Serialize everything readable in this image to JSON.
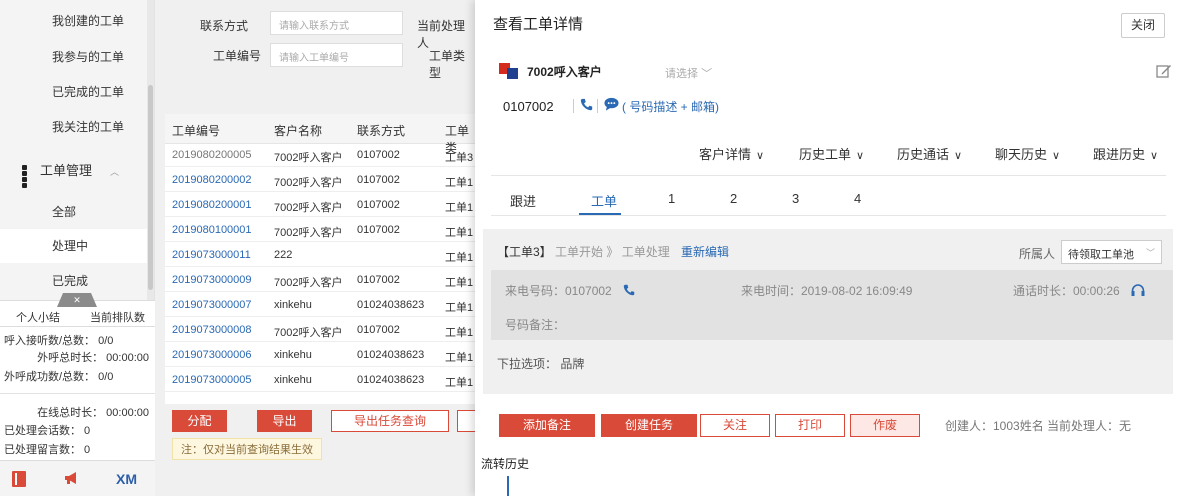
{
  "sidebar": {
    "items": [
      {
        "label": "我创建的工单"
      },
      {
        "label": "我参与的工单"
      },
      {
        "label": "已完成的工单"
      },
      {
        "label": "我关注的工单"
      }
    ],
    "group": {
      "label": "工单管理"
    },
    "group_items": [
      {
        "label": "全部"
      },
      {
        "label": "处理中"
      },
      {
        "label": "已完成"
      }
    ],
    "stats": {
      "tab_personal": "个人小结",
      "tab_queue": "当前排队数",
      "lines": [
        "呼入接听数/总数： 0/0",
        "外呼总时长： 00:00:00",
        "外呼成功数/总数： 0/0",
        "在线总时长： 00:00:00",
        "已处理会话数： 0",
        "已处理留言数： 0"
      ]
    },
    "bottom": {
      "xm": "XM"
    }
  },
  "form": {
    "contact_label": "联系方式",
    "contact_placeholder": "请输入联系方式",
    "handler_label": "当前处理人",
    "order_no_label": "工单编号",
    "order_no_placeholder": "请输入工单编号",
    "order_type_label": "工单类型"
  },
  "table": {
    "headers": [
      "工单编号",
      "客户名称",
      "联系方式",
      "工单类"
    ],
    "rows": [
      [
        "2019080200005",
        "7002呼入客户",
        "0107002",
        "工单3"
      ],
      [
        "2019080200002",
        "7002呼入客户",
        "0107002",
        "工单1"
      ],
      [
        "2019080200001",
        "7002呼入客户",
        "0107002",
        "工单1"
      ],
      [
        "2019080100001",
        "7002呼入客户",
        "0107002",
        "工单1"
      ],
      [
        "2019073000011",
        "222",
        "",
        "工单1"
      ],
      [
        "2019073000009",
        "7002呼入客户",
        "0107002",
        "工单1"
      ],
      [
        "2019073000007",
        "xinkehu",
        "01024038623",
        "工单1"
      ],
      [
        "2019073000008",
        "7002呼入客户",
        "0107002",
        "工单1"
      ],
      [
        "2019073000006",
        "xinkehu",
        "01024038623",
        "工单1"
      ],
      [
        "2019073000005",
        "xinkehu",
        "01024038623",
        "工单1"
      ]
    ],
    "buttons": {
      "assign": "分配",
      "export": "导出",
      "export_query": "导出任务查询"
    },
    "note": "注：仅对当前查询结果生效"
  },
  "panel": {
    "title": "查看工单详情",
    "close": "关闭",
    "customer_name": "7002呼入客户",
    "select_hint": "请选择",
    "phone": "0107002",
    "desc_link": "( 号码描述 + 邮箱)",
    "nav_tabs": [
      "客户详情",
      "历史工单",
      "历史通话",
      "聊天历史",
      "跟进历史"
    ],
    "sub_tabs": [
      "跟进",
      "工单",
      "1",
      "2",
      "3",
      "4"
    ],
    "order": {
      "tag": "【工单3】",
      "flow": "工单开始 》 工单处理",
      "edit": "重新编辑",
      "owner_label": "所属人",
      "owner_value": "待领取工单池",
      "call_no": "来电号码：0107002",
      "call_time": "来电时间：2019-08-02 16:09:49",
      "call_duration": "通话时长：00:00:26",
      "remark": "号码备注：",
      "dropdown": "下拉选项：  品牌"
    },
    "actions": {
      "add_remark": "添加备注",
      "create_task": "创建任务",
      "follow": "关注",
      "print": "打印",
      "void": "作废"
    },
    "creator": "创建人：1003姓名   当前处理人：无",
    "flow_history": "流转历史"
  },
  "colors": {
    "accent_red": "#d94a38",
    "link_blue": "#2a69b3"
  }
}
